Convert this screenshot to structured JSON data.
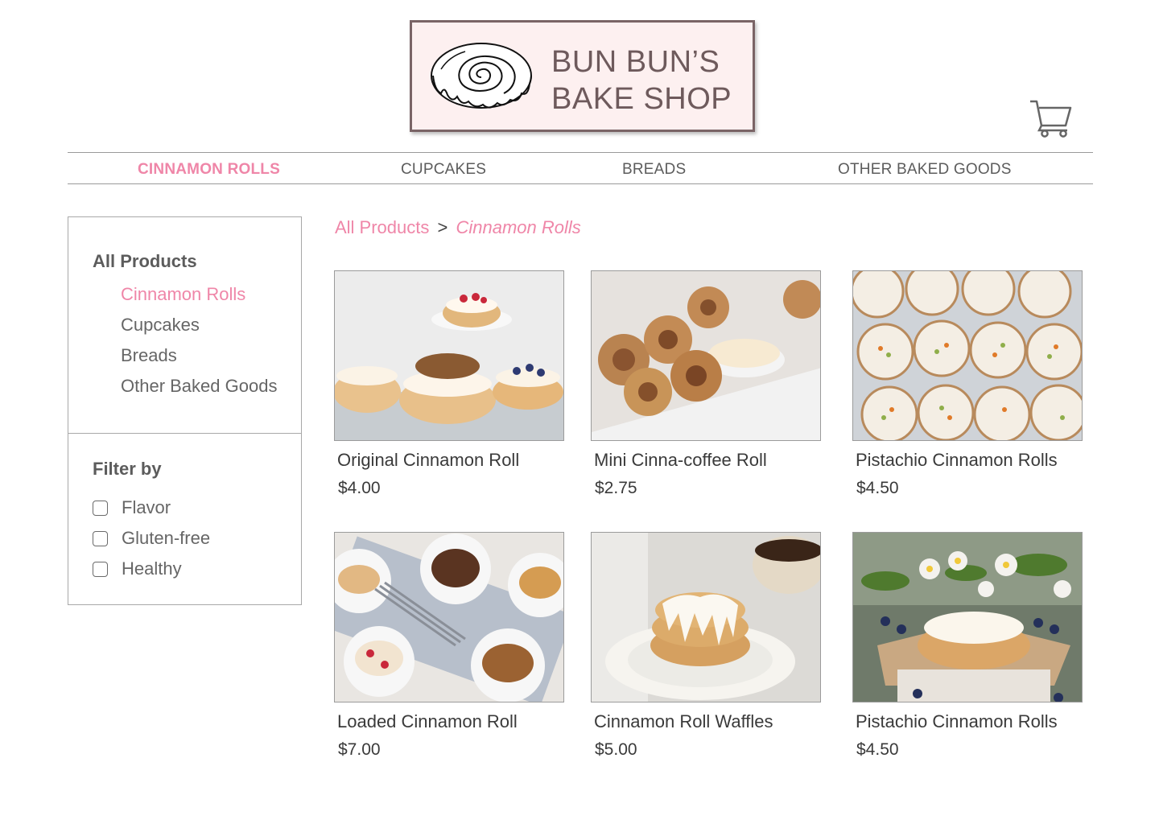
{
  "brand": {
    "line1": "BUN BUN’S",
    "line2": "BAKE SHOP",
    "logo_icon": "cinnamon-roll-icon",
    "background": "#fdf0f0",
    "text_color": "#6e5a5c"
  },
  "header": {
    "cart_icon": "shopping-cart-icon"
  },
  "nav": {
    "items": [
      {
        "label": "CINNAMON ROLLS",
        "active": true
      },
      {
        "label": "CUPCAKES",
        "active": false
      },
      {
        "label": "BREADS",
        "active": false
      },
      {
        "label": "OTHER BAKED GOODS",
        "active": false
      }
    ]
  },
  "sidebar": {
    "heading": "All Products",
    "categories": [
      {
        "label": "Cinnamon Rolls",
        "active": true
      },
      {
        "label": "Cupcakes",
        "active": false
      },
      {
        "label": "Breads",
        "active": false
      },
      {
        "label": "Other Baked Goods",
        "active": false
      }
    ],
    "filter_heading": "Filter by",
    "filters": [
      {
        "label": "Flavor",
        "checked": false
      },
      {
        "label": "Gluten-free",
        "checked": false
      },
      {
        "label": "Healthy",
        "checked": false
      }
    ]
  },
  "breadcrumb": {
    "root": "All Products",
    "separator": ">",
    "current": "Cinnamon Rolls"
  },
  "products": [
    {
      "name": "Original Cinnamon Roll",
      "price": "$4.00",
      "image": "photo of cinnamon rolls with berries"
    },
    {
      "name": "Mini Cinna-coffee Roll",
      "price": "$2.75",
      "image": "photo of mini cinnamon rolls with cream"
    },
    {
      "name": "Pistachio Cinnamon Rolls",
      "price": "$4.50",
      "image": "photo of pistachio cinnamon rolls"
    },
    {
      "name": "Loaded Cinnamon Roll",
      "price": "$7.00",
      "image": "photo of loaded cinnamon rolls on plates"
    },
    {
      "name": "Cinnamon Roll Waffles",
      "price": "$5.00",
      "image": "photo of cinnamon roll waffles"
    },
    {
      "name": "Pistachio Cinnamon Rolls",
      "price": "$4.50",
      "image": "photo of cinnamon roll with flowers"
    }
  ],
  "colors": {
    "accent_pink": "#ef86a8",
    "text_gray": "#5c5c5c",
    "border_gray": "#a8a8a8"
  }
}
